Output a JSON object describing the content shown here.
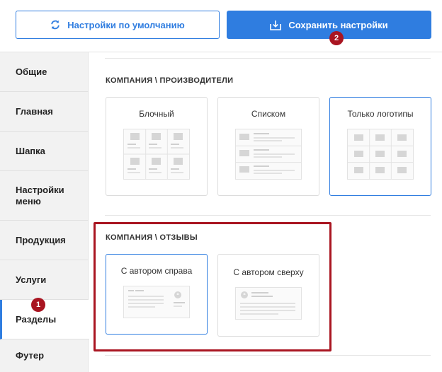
{
  "toolbar": {
    "default_label": "Настройки по умолчанию",
    "save_label": "Сохранить настройки",
    "save_badge": "2",
    "accent_color": "#2f7de0"
  },
  "sidebar": {
    "items": [
      {
        "label": "Общие"
      },
      {
        "label": "Главная"
      },
      {
        "label": "Шапка"
      },
      {
        "label": "Настройки меню"
      },
      {
        "label": "Продукция"
      },
      {
        "label": "Услуги"
      },
      {
        "label": "Разделы",
        "active": true
      },
      {
        "label": "Футер"
      }
    ],
    "active_badge": "1"
  },
  "sections": [
    {
      "title": "КОМПАНИЯ \\ ПРОИЗВОДИТЕЛИ",
      "options": [
        {
          "label": "Блочный",
          "selected": false
        },
        {
          "label": "Списком",
          "selected": false
        },
        {
          "label": "Только логотипы",
          "selected": true
        }
      ]
    },
    {
      "title": "КОМПАНИЯ \\ ОТЗЫВЫ",
      "options": [
        {
          "label": "С автором справа",
          "selected": true
        },
        {
          "label": "С автором сверху",
          "selected": false
        }
      ]
    }
  ],
  "highlight_color": "#a91521"
}
